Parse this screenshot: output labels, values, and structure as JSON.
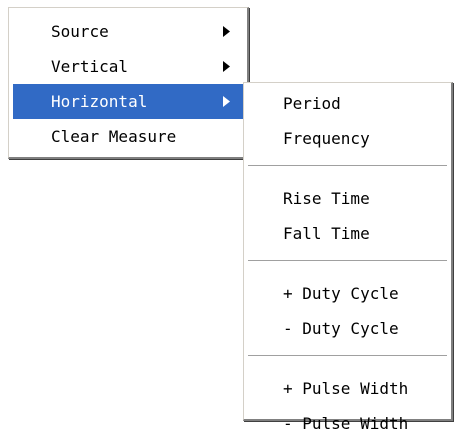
{
  "main_menu": {
    "items": [
      {
        "label": "Source",
        "has_submenu": true,
        "icon": "chevron-right-icon"
      },
      {
        "label": "Vertical",
        "has_submenu": true,
        "icon": "chevron-right-icon"
      },
      {
        "label": "Horizontal",
        "has_submenu": true,
        "highlighted": true,
        "icon": "chevron-right-icon"
      },
      {
        "label": "Clear Measure",
        "has_submenu": false
      }
    ]
  },
  "horizontal_submenu": {
    "groups": [
      {
        "items": [
          {
            "label": "Period"
          },
          {
            "label": "Frequency"
          }
        ]
      },
      {
        "items": [
          {
            "label": "Rise Time"
          },
          {
            "label": "Fall Time"
          }
        ]
      },
      {
        "items": [
          {
            "label": "+ Duty Cycle"
          },
          {
            "label": "- Duty Cycle"
          }
        ]
      },
      {
        "items": [
          {
            "label": "+ Pulse Width"
          },
          {
            "label": "- Pulse Width"
          }
        ]
      }
    ]
  },
  "colors": {
    "highlight_bg": "#316ac5",
    "highlight_text": "#ffffff",
    "menu_bg": "#ffffff",
    "text": "#000000"
  }
}
